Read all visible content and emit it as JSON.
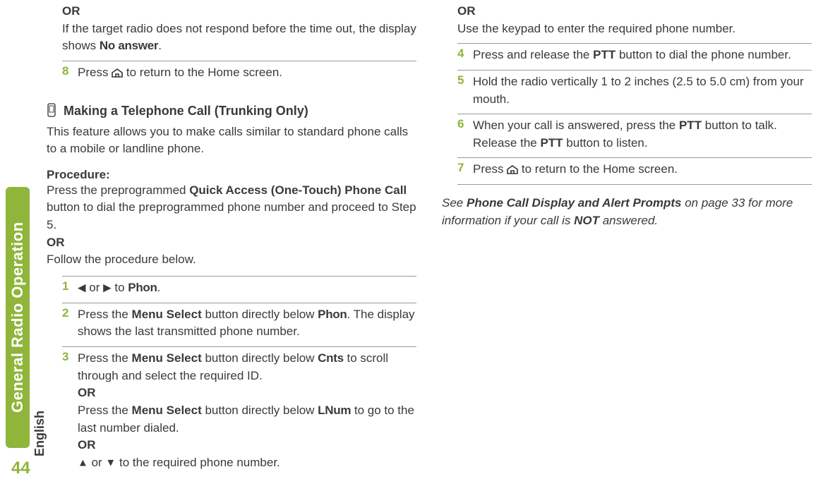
{
  "sidebar": {
    "chapter_label": "General Radio Operation",
    "page_number": "44",
    "language": "English"
  },
  "col1": {
    "lead": {
      "or": "OR",
      "text1": "If the target radio does not respond before the time out, the display shows ",
      "code1": "No answer",
      "text2": "."
    },
    "step8": {
      "num": "8",
      "pre": "Press ",
      "post": " to return to the Home screen."
    },
    "section_title": "Making a Telephone Call (Trunking Only)",
    "intro": "This feature allows you to make calls similar to standard phone calls to a mobile or landline phone.",
    "proc_label": "Procedure:",
    "proc_body_a": "Press the preprogrammed ",
    "proc_body_bold": "Quick Access (One-Touch) Phone Call",
    "proc_body_b": " button to dial the preprogrammed phone number and proceed to Step 5.",
    "proc_or": "OR",
    "proc_body_c": "Follow the procedure below.",
    "step1": {
      "num": "1",
      "to": " to ",
      "code": "Phon",
      "end": ".",
      "or_word": " or "
    },
    "step2": {
      "num": "2",
      "a": "Press the ",
      "bold": "Menu Select",
      "b": " button directly below ",
      "code": "Phon",
      "c": ". The display shows the last transmitted phone number."
    },
    "step3": {
      "num": "3",
      "a1": "Press the ",
      "b1": "Menu Select",
      "c1": " button directly below ",
      "code1": "Cnts",
      "d1": " to scroll through and select the required ID.",
      "or1": "OR",
      "a2": "Press the ",
      "b2": "Menu Select",
      "c2": " button directly below ",
      "code2": "LNum",
      "d2": " to go to the last number dialed.",
      "or2": "OR",
      "e": " to the required phone number.",
      "or_word": " or "
    }
  },
  "col2": {
    "lead": {
      "or": "OR",
      "text": "Use the keypad to enter the required phone number."
    },
    "step4": {
      "num": "4",
      "a": "Press and release the ",
      "ptt": "PTT",
      "b": " button to dial the phone number."
    },
    "step5": {
      "num": "5",
      "text": "Hold the radio vertically 1 to 2 inches (2.5 to 5.0 cm) from your mouth."
    },
    "step6": {
      "num": "6",
      "a": "When your call is answered, press the ",
      "ptt1": "PTT",
      "b": " button to talk. Release the ",
      "ptt2": "PTT",
      "c": " button to listen."
    },
    "step7": {
      "num": "7",
      "pre": "Press ",
      "post": " to return to the Home screen."
    },
    "note": {
      "a": "See ",
      "bold1": "Phone Call Display and Alert Prompts",
      "b": " on page 33 for more information if your call is ",
      "bold2": "NOT",
      "c": " answered."
    }
  }
}
